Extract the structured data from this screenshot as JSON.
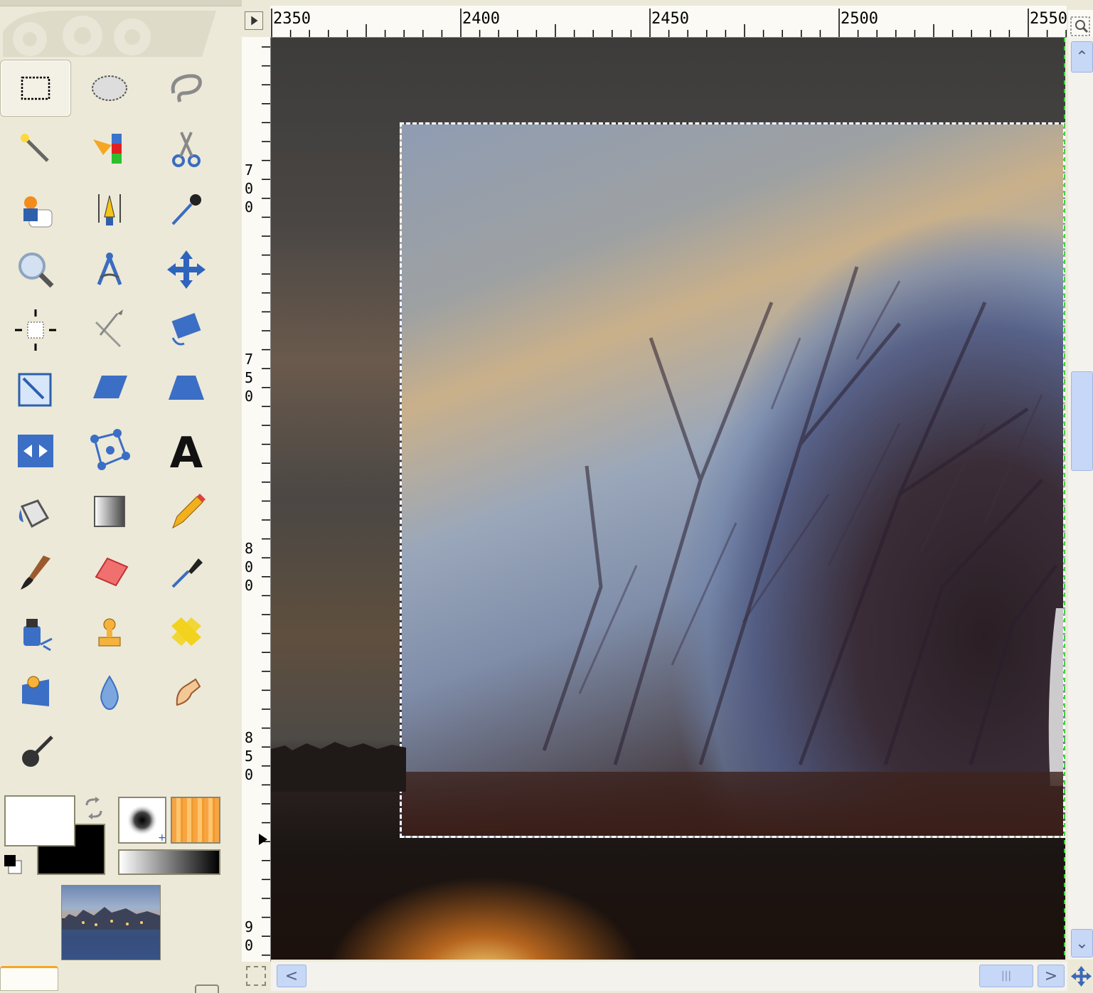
{
  "toolbox": {
    "tools": [
      {
        "name": "Rectangle Select",
        "icon": "rect-select-icon"
      },
      {
        "name": "Ellipse Select",
        "icon": "ellipse-select-icon"
      },
      {
        "name": "Free Select",
        "icon": "lasso-icon"
      },
      {
        "name": "Fuzzy Select",
        "icon": "magic-wand-icon"
      },
      {
        "name": "Select by Color",
        "icon": "select-by-color-icon"
      },
      {
        "name": "Scissors Select",
        "icon": "scissors-icon"
      },
      {
        "name": "Foreground Select",
        "icon": "foreground-select-icon"
      },
      {
        "name": "Paths",
        "icon": "paths-icon"
      },
      {
        "name": "Color Picker",
        "icon": "color-picker-icon"
      },
      {
        "name": "Zoom",
        "icon": "zoom-icon"
      },
      {
        "name": "Measure",
        "icon": "measure-icon"
      },
      {
        "name": "Move",
        "icon": "move-icon"
      },
      {
        "name": "Alignment",
        "icon": "align-icon"
      },
      {
        "name": "Crop",
        "icon": "crop-icon"
      },
      {
        "name": "Rotate",
        "icon": "rotate-icon"
      },
      {
        "name": "Scale",
        "icon": "scale-icon"
      },
      {
        "name": "Shear",
        "icon": "shear-icon"
      },
      {
        "name": "Perspective",
        "icon": "perspective-icon"
      },
      {
        "name": "Flip",
        "icon": "flip-icon"
      },
      {
        "name": "Cage Transform",
        "icon": "cage-icon"
      },
      {
        "name": "Text",
        "icon": "text-icon"
      },
      {
        "name": "Bucket Fill",
        "icon": "bucket-icon"
      },
      {
        "name": "Blend",
        "icon": "gradient-icon"
      },
      {
        "name": "Pencil",
        "icon": "pencil-icon"
      },
      {
        "name": "Paintbrush",
        "icon": "paintbrush-icon"
      },
      {
        "name": "Eraser",
        "icon": "eraser-icon"
      },
      {
        "name": "Airbrush",
        "icon": "airbrush-icon"
      },
      {
        "name": "Ink",
        "icon": "ink-icon"
      },
      {
        "name": "Clone",
        "icon": "clone-icon"
      },
      {
        "name": "Heal",
        "icon": "heal-icon"
      },
      {
        "name": "Perspective Clone",
        "icon": "perspective-clone-icon"
      },
      {
        "name": "Blur / Sharpen",
        "icon": "blur-icon"
      },
      {
        "name": "Smudge",
        "icon": "smudge-icon"
      },
      {
        "name": "Dodge / Burn",
        "icon": "dodge-burn-icon"
      }
    ],
    "text_tool_glyph": "A",
    "foreground_color": "#ffffff",
    "background_color": "#000000",
    "pattern_color": "#f7a441"
  },
  "ruler": {
    "top_labels": [
      "2350",
      "2400",
      "2450",
      "2500",
      "2550"
    ],
    "left_labels": [
      [
        "7",
        "0",
        "0"
      ],
      [
        "7",
        "5",
        "0"
      ],
      [
        "8",
        "0",
        "0"
      ],
      [
        "8",
        "5",
        "0"
      ],
      [
        "9",
        "0"
      ]
    ]
  },
  "canvas": {
    "selection_border_color": "#ffffff",
    "layer_boundary_color": "#d69a30"
  },
  "scrollbar": {
    "up_arrow": "⌃",
    "down_arrow": "⌄",
    "left_arrow": "<",
    "right_arrow": ">",
    "grip": "|||"
  }
}
